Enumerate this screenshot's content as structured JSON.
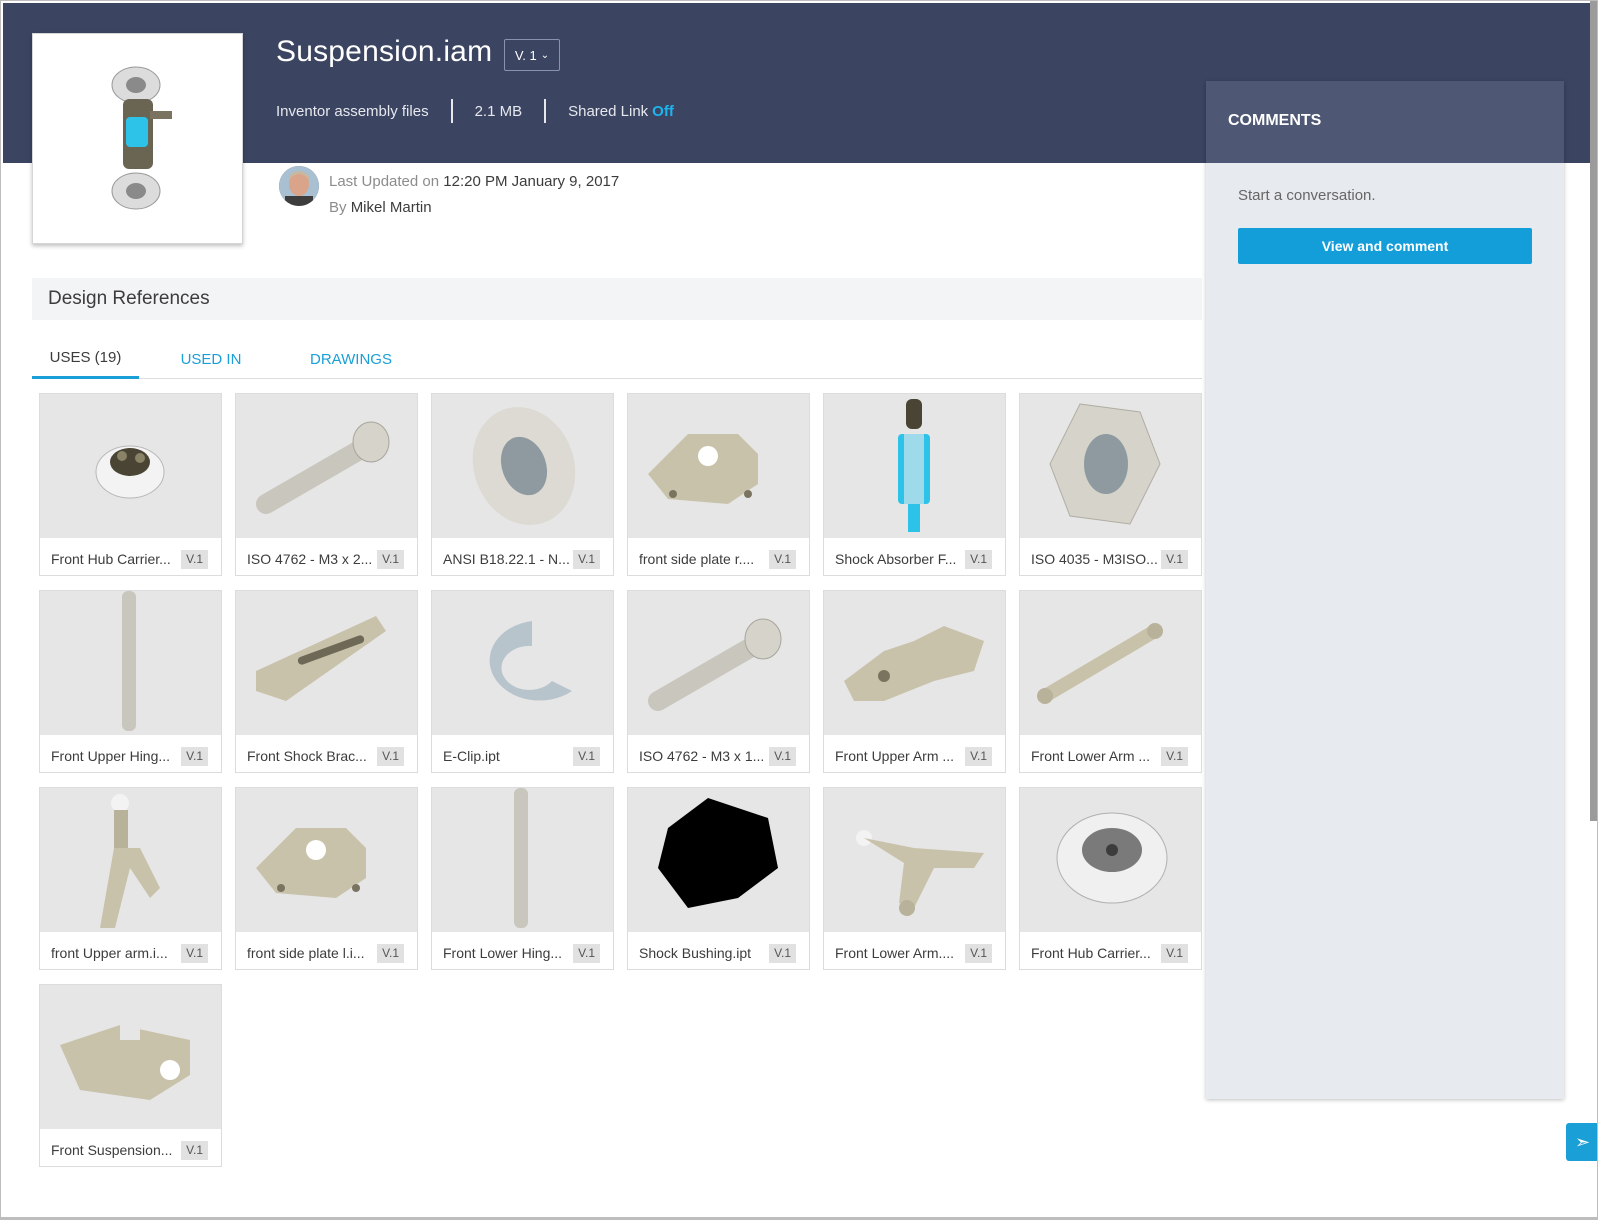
{
  "file": {
    "title": "Suspension.iam",
    "version": "V. 1",
    "type": "Inventor assembly files",
    "size": "2.1 MB",
    "shared_link_label": "Shared Link",
    "shared_link_state": "Off"
  },
  "updated": {
    "label": "Last Updated on",
    "timestamp": "12:20 PM January 9, 2017",
    "by_label": "By",
    "author": "Mikel Martin"
  },
  "references": {
    "title": "Design References",
    "tabs": [
      {
        "label": "USES (19)",
        "active": true
      },
      {
        "label": "USED IN",
        "active": false
      },
      {
        "label": "DRAWINGS",
        "active": false
      }
    ],
    "items": [
      {
        "name": "Front Hub Carrier...",
        "version": "V.1",
        "icon": "wheel-hub"
      },
      {
        "name": "ISO 4762 - M3 x 2...",
        "version": "V.1",
        "icon": "bolt"
      },
      {
        "name": "ANSI B18.22.1 - N...",
        "version": "V.1",
        "icon": "washer"
      },
      {
        "name": "front side plate r....",
        "version": "V.1",
        "icon": "side-plate"
      },
      {
        "name": "Shock Absorber F...",
        "version": "V.1",
        "icon": "shock-absorber"
      },
      {
        "name": "ISO 4035 - M3ISO...",
        "version": "V.1",
        "icon": "hex-nut"
      },
      {
        "name": "Front Upper Hing...",
        "version": "V.1",
        "icon": "pin"
      },
      {
        "name": "Front Shock Brac...",
        "version": "V.1",
        "icon": "bracket"
      },
      {
        "name": "E-Clip.ipt",
        "version": "V.1",
        "icon": "e-clip"
      },
      {
        "name": "ISO 4762 - M3 x 1...",
        "version": "V.1",
        "icon": "bolt"
      },
      {
        "name": "Front Upper Arm ...",
        "version": "V.1",
        "icon": "upper-arm"
      },
      {
        "name": "Front Lower Arm ...",
        "version": "V.1",
        "icon": "link-arm"
      },
      {
        "name": "front Upper arm.i...",
        "version": "V.1",
        "icon": "upright"
      },
      {
        "name": "front side plate l.i...",
        "version": "V.1",
        "icon": "side-plate"
      },
      {
        "name": "Front Lower Hing...",
        "version": "V.1",
        "icon": "pin"
      },
      {
        "name": "Shock Bushing.ipt",
        "version": "V.1",
        "icon": "bushing"
      },
      {
        "name": "Front Lower Arm....",
        "version": "V.1",
        "icon": "a-arm"
      },
      {
        "name": "Front Hub Carrier...",
        "version": "V.1",
        "icon": "wheel"
      },
      {
        "name": "Front Suspension...",
        "version": "V.1",
        "icon": "mount"
      }
    ]
  },
  "comments": {
    "title": "COMMENTS",
    "empty_text": "Start a conversation.",
    "button_label": "View and comment"
  },
  "colors": {
    "header_bg": "#3b4461",
    "accent": "#1a9fd6",
    "link_off": "#1eb4ee"
  }
}
